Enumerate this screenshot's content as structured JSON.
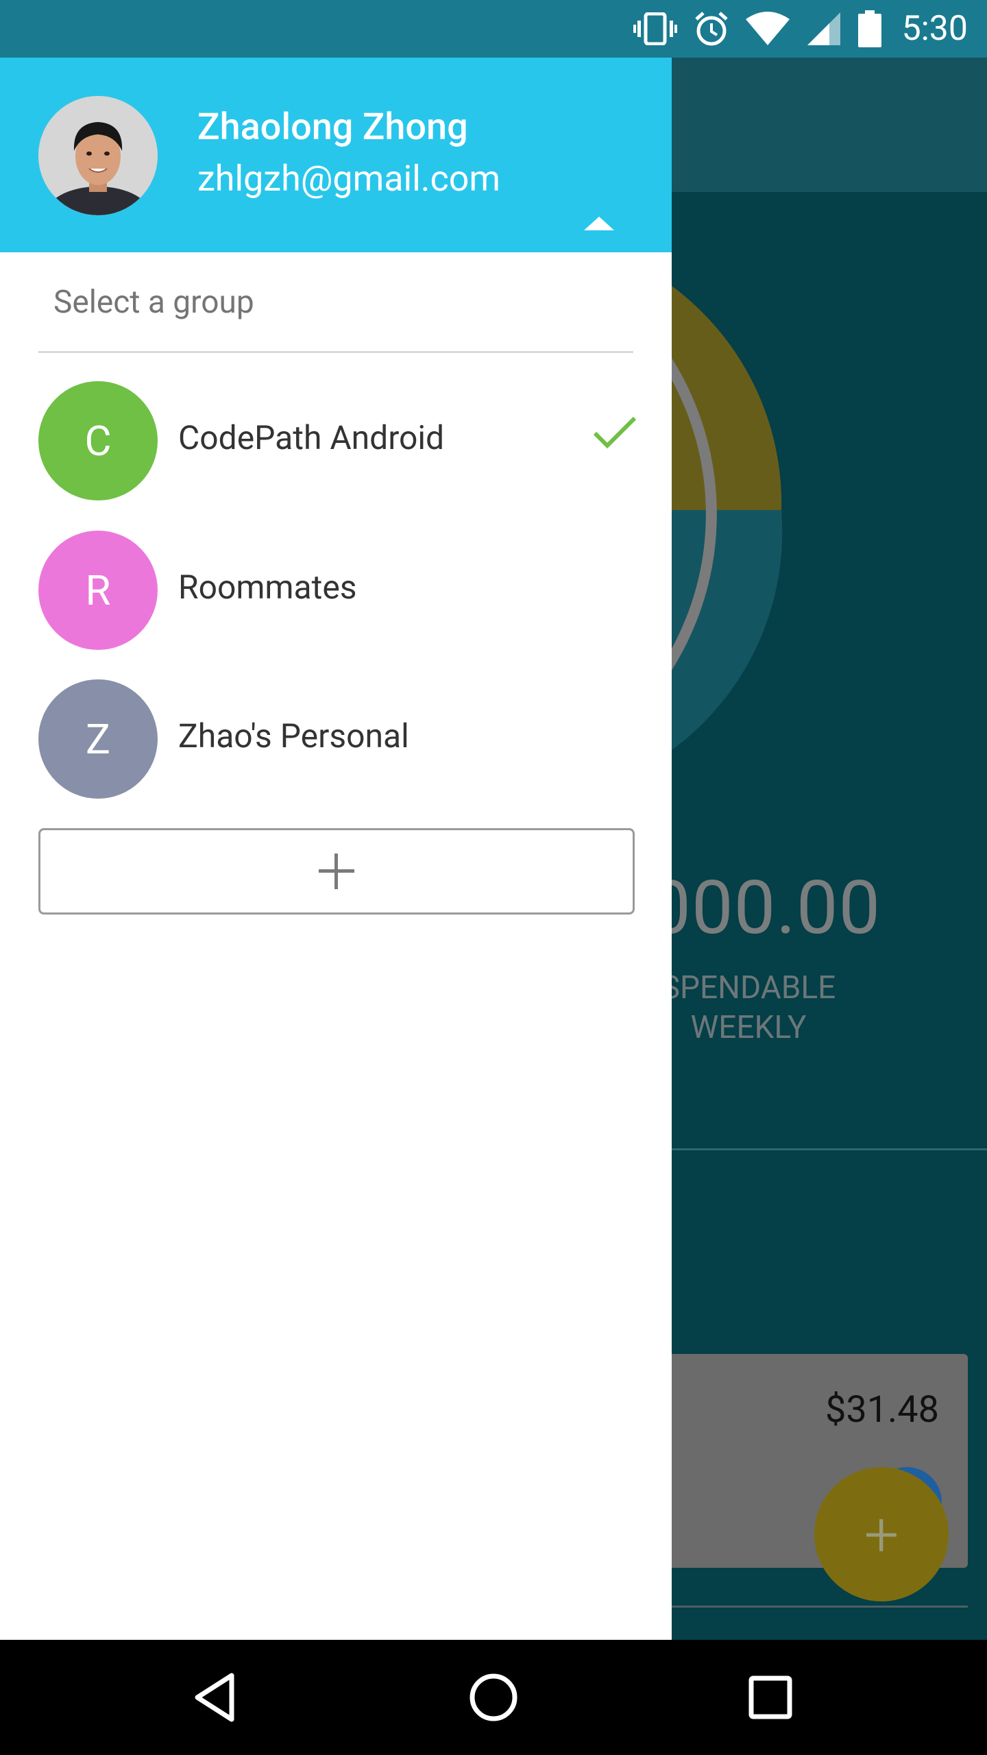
{
  "status_bar": {
    "time": "5:30",
    "icons": [
      "vibrate-icon",
      "alarm-icon",
      "wifi-icon",
      "signal-icon",
      "battery-icon"
    ]
  },
  "drawer": {
    "user": {
      "name": "Zhaolong Zhong",
      "email": "zhlgzh@gmail.com"
    },
    "select_label": "Select a group",
    "groups": [
      {
        "initial": "C",
        "name": "CodePath Android",
        "color": "#6fc044",
        "selected": true
      },
      {
        "initial": "R",
        "name": "Roommates",
        "color": "#ec77db",
        "selected": false
      },
      {
        "initial": "Z",
        "name": "Zhao's Personal",
        "color": "#8790a8",
        "selected": false
      }
    ],
    "add_button_icon": "plus-icon",
    "accent_color": "#29c6eb",
    "check_color": "#6fc044"
  },
  "background_app": {
    "amount": ",000.00",
    "label_line1": "SPENDABLE",
    "label_line2": "WEEKLY",
    "card_amount": "$31.48",
    "fab_icon": "plus-icon"
  },
  "nav_bar": {
    "icons": [
      "back-icon",
      "home-icon",
      "recents-icon"
    ]
  }
}
